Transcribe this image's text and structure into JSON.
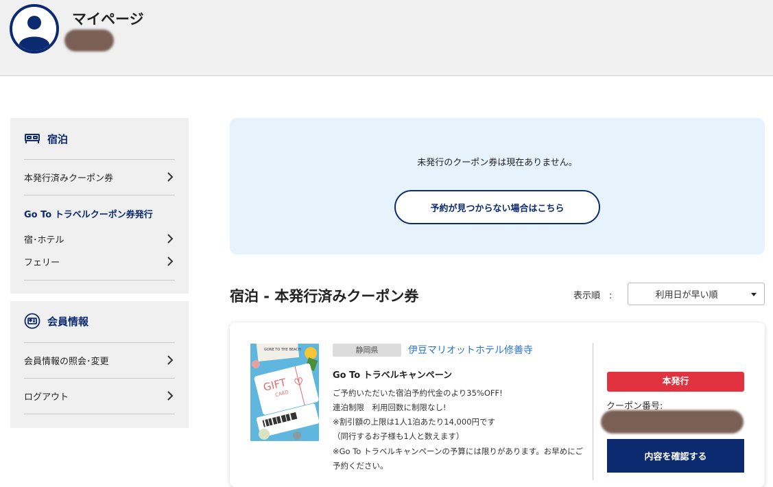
{
  "header": {
    "title": "マイページ"
  },
  "sidebar": {
    "stay": {
      "heading": "宿泊",
      "icon": "bed-icon",
      "items": [
        {
          "label": "本発行済みクーポン券"
        }
      ],
      "subheading": "Go To トラベルクーポン券発行",
      "sub_items": [
        {
          "label": "宿･ホテル"
        },
        {
          "label": "フェリー"
        }
      ]
    },
    "member": {
      "heading": "会員情報",
      "icon": "id-card-icon",
      "items": [
        {
          "label": "会員情報の照会･変更"
        },
        {
          "label": "ログアウト"
        }
      ]
    }
  },
  "notice": {
    "message": "未発行のクーポン券は現在ありません。",
    "button_label": "予約が見つからない場合はこちら"
  },
  "section": {
    "title": "宿泊 - 本発行済みクーポン券",
    "sort_label": "表示順　:",
    "sort_selected": "利用日が早い順"
  },
  "coupon_card": {
    "image_text": {
      "gift": "GIFT",
      "card": "CARD",
      "beach": "GONE TO THE BEACH"
    },
    "prefecture": "静岡県",
    "hotel_name": "伊豆マリオットホテル修善寺",
    "campaign_title": "Go To トラベルキャンペーン",
    "description": [
      "ご予約いただいた宿泊予約代金のより35%OFF!",
      "連泊制限　利用回数に制限なし!",
      "※割引額の上限は1人1泊あたり14,000円です",
      "（同行するお子様も1人と数えます）",
      "※Go To トラベルキャンペーンの予算には限りがあります。お早めにご",
      "予約ください。"
    ],
    "status": "本発行",
    "coupon_number_label": "クーポン番号:",
    "confirm_button": "内容を確認する"
  },
  "colors": {
    "brand_navy": "#0b2a6f",
    "link_blue": "#2a73c8",
    "status_red": "#e0323f",
    "notice_bg": "#e6f2fc",
    "panel_gray": "#f0f0f0"
  }
}
